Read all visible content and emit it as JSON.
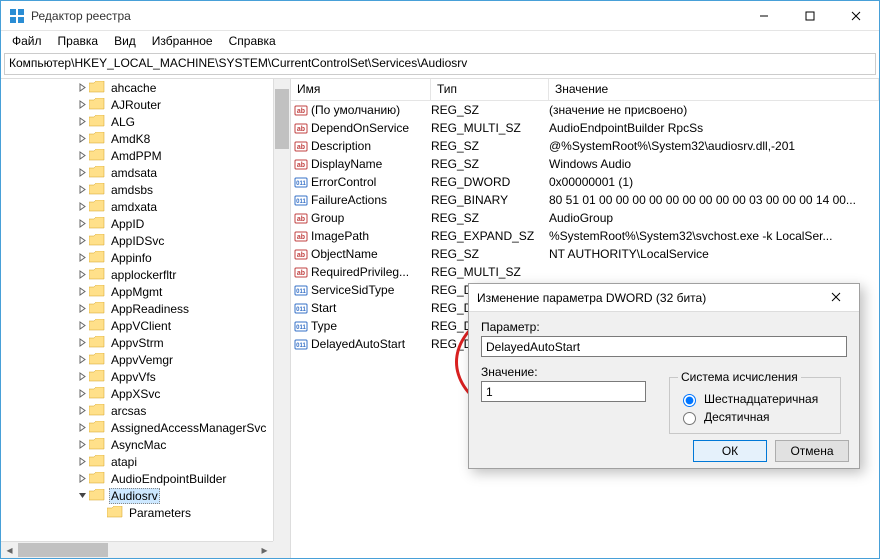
{
  "window": {
    "title": "Редактор реестра"
  },
  "menu": {
    "file": "Файл",
    "edit": "Правка",
    "view": "Вид",
    "favorites": "Избранное",
    "help": "Справка"
  },
  "addressbar": "Компьютер\\HKEY_LOCAL_MACHINE\\SYSTEM\\CurrentControlSet\\Services\\Audiosrv",
  "tree": [
    {
      "label": "ahcache",
      "depth": 3,
      "tw": ">"
    },
    {
      "label": "AJRouter",
      "depth": 3,
      "tw": ">"
    },
    {
      "label": "ALG",
      "depth": 3,
      "tw": ">"
    },
    {
      "label": "AmdK8",
      "depth": 3,
      "tw": ">"
    },
    {
      "label": "AmdPPM",
      "depth": 3,
      "tw": ">"
    },
    {
      "label": "amdsata",
      "depth": 3,
      "tw": ">"
    },
    {
      "label": "amdsbs",
      "depth": 3,
      "tw": ">"
    },
    {
      "label": "amdxata",
      "depth": 3,
      "tw": ">"
    },
    {
      "label": "AppID",
      "depth": 3,
      "tw": ">"
    },
    {
      "label": "AppIDSvc",
      "depth": 3,
      "tw": ">"
    },
    {
      "label": "Appinfo",
      "depth": 3,
      "tw": ">"
    },
    {
      "label": "applockerfltr",
      "depth": 3,
      "tw": ">"
    },
    {
      "label": "AppMgmt",
      "depth": 3,
      "tw": ">"
    },
    {
      "label": "AppReadiness",
      "depth": 3,
      "tw": ">"
    },
    {
      "label": "AppVClient",
      "depth": 3,
      "tw": ">"
    },
    {
      "label": "AppvStrm",
      "depth": 3,
      "tw": ">"
    },
    {
      "label": "AppvVemgr",
      "depth": 3,
      "tw": ">"
    },
    {
      "label": "AppvVfs",
      "depth": 3,
      "tw": ">"
    },
    {
      "label": "AppXSvc",
      "depth": 3,
      "tw": ">"
    },
    {
      "label": "arcsas",
      "depth": 3,
      "tw": ">"
    },
    {
      "label": "AssignedAccessManagerSvc",
      "depth": 3,
      "tw": ">"
    },
    {
      "label": "AsyncMac",
      "depth": 3,
      "tw": ">"
    },
    {
      "label": "atapi",
      "depth": 3,
      "tw": ">"
    },
    {
      "label": "AudioEndpointBuilder",
      "depth": 3,
      "tw": ">"
    },
    {
      "label": "Audiosrv",
      "depth": 3,
      "tw": "v",
      "selected": true
    },
    {
      "label": "Parameters",
      "depth": 4,
      "tw": ""
    }
  ],
  "columns": {
    "name": "Имя",
    "type": "Тип",
    "value": "Значение"
  },
  "values": [
    {
      "icon": "str",
      "name": "(По умолчанию)",
      "type": "REG_SZ",
      "val": "(значение не присвоено)"
    },
    {
      "icon": "str",
      "name": "DependOnService",
      "type": "REG_MULTI_SZ",
      "val": "AudioEndpointBuilder RpcSs"
    },
    {
      "icon": "str",
      "name": "Description",
      "type": "REG_SZ",
      "val": "@%SystemRoot%\\System32\\audiosrv.dll,-201"
    },
    {
      "icon": "str",
      "name": "DisplayName",
      "type": "REG_SZ",
      "val": "Windows Audio"
    },
    {
      "icon": "bin",
      "name": "ErrorControl",
      "type": "REG_DWORD",
      "val": "0x00000001 (1)"
    },
    {
      "icon": "bin",
      "name": "FailureActions",
      "type": "REG_BINARY",
      "val": "80 51 01 00 00 00 00 00 00 00 00 00 03 00 00 00 14 00..."
    },
    {
      "icon": "str",
      "name": "Group",
      "type": "REG_SZ",
      "val": "AudioGroup"
    },
    {
      "icon": "str",
      "name": "ImagePath",
      "type": "REG_EXPAND_SZ",
      "val": "%SystemRoot%\\System32\\svchost.exe -k LocalSer..."
    },
    {
      "icon": "str",
      "name": "ObjectName",
      "type": "REG_SZ",
      "val": "NT AUTHORITY\\LocalService"
    },
    {
      "icon": "str",
      "name": "RequiredPrivileg...",
      "type": "REG_MULTI_SZ",
      "val": ""
    },
    {
      "icon": "bin",
      "name": "ServiceSidType",
      "type": "REG_DWORD",
      "val": ""
    },
    {
      "icon": "bin",
      "name": "Start",
      "type": "REG_DWORD",
      "val": ""
    },
    {
      "icon": "bin",
      "name": "Type",
      "type": "REG_DWORD",
      "val": ""
    },
    {
      "icon": "bin",
      "name": "DelayedAutoStart",
      "type": "REG_DWORD",
      "val": ""
    }
  ],
  "dialog": {
    "title": "Изменение параметра DWORD (32 бита)",
    "param_label": "Параметр:",
    "param_value": "DelayedAutoStart",
    "value_label": "Значение:",
    "value": "1",
    "base_label": "Система исчисления",
    "hex": "Шестнадцатеричная",
    "dec": "Десятичная",
    "ok": "ОК",
    "cancel": "Отмена"
  }
}
